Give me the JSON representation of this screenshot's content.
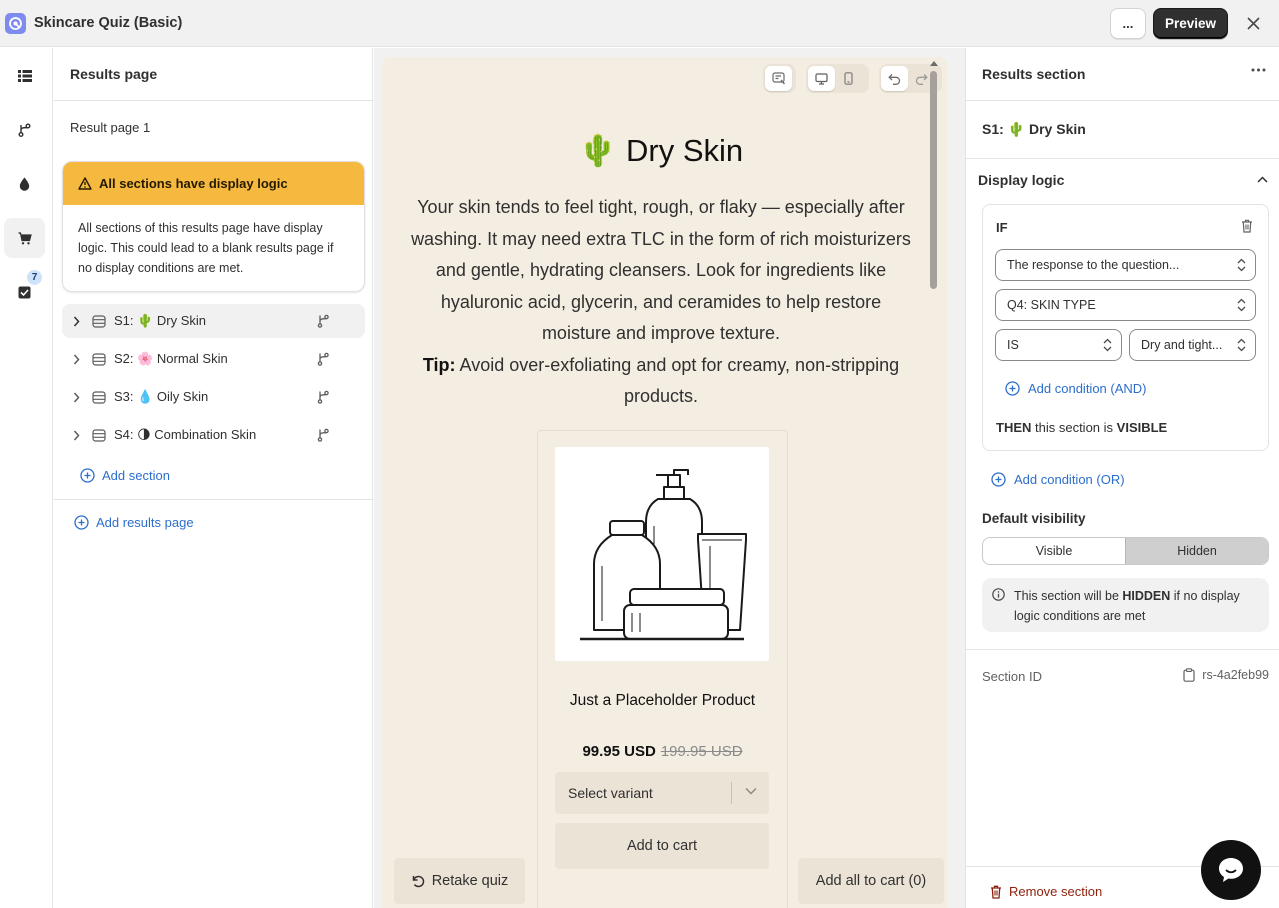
{
  "app": {
    "title": "Skincare Quiz (Basic)",
    "more_label": "...",
    "preview_label": "Preview"
  },
  "rail": {
    "badge_count": "7"
  },
  "left": {
    "header": "Results page",
    "result_page": "Result page 1",
    "banner_title": "All sections have display logic",
    "banner_body": "All sections of this results page have display logic. This could lead to a blank results page if no display conditions are met.",
    "sections": [
      {
        "label": "S1:  🌵  Dry Skin"
      },
      {
        "label": "S2:  🌸  Normal Skin"
      },
      {
        "label": "S3:  💧  Oily Skin"
      },
      {
        "label": "S4:  🌗  Combination Skin"
      }
    ],
    "add_section": "Add section",
    "add_results_page": "Add results page"
  },
  "canvas": {
    "title": "🌵 Dry Skin",
    "description": "Your skin tends to feel tight, rough, or flaky — especially after washing. It may need extra TLC in the form of rich moisturizers and gentle, hydrating cleansers. Look for ingredients like hyaluronic acid, glycerin, and ceramides to help restore moisture and improve texture.",
    "tip_label": "Tip:",
    "tip_text": " Avoid over-exfoliating and opt for creamy, non-stripping products.",
    "product": {
      "name": "Just a Placeholder Product",
      "price": "99.95 USD",
      "compare_price": "199.95 USD",
      "variant_placeholder": "Select variant",
      "add_to_cart": "Add to cart"
    },
    "retake": "Retake quiz",
    "add_all": "Add all to cart (0)"
  },
  "right": {
    "header": "Results section",
    "section_title": "S1:  🌵  Dry Skin",
    "display_logic": "Display logic",
    "if_label": "IF",
    "condition_source": "The response to the question...",
    "question": "Q4: SKIN TYPE",
    "operator": "IS",
    "value": "Dry and tight...",
    "add_and": "Add condition (AND)",
    "then_prefix": "THEN",
    "then_middle": " this section is ",
    "then_state": "VISIBLE",
    "add_or": "Add condition (OR)",
    "default_visibility": "Default visibility",
    "visible_opt": "Visible",
    "hidden_opt": "Hidden",
    "notice_a": "This section will be ",
    "notice_b": "HIDDEN",
    "notice_c": " if no display logic conditions are met",
    "section_id_label": "Section ID",
    "section_id": "rs-4a2feb99",
    "remove": "Remove section"
  },
  "colors": {
    "banner": "#f5b93f",
    "link": "#2c6ecb",
    "canvas": "#f4ede1",
    "danger": "#8e1f0b"
  }
}
